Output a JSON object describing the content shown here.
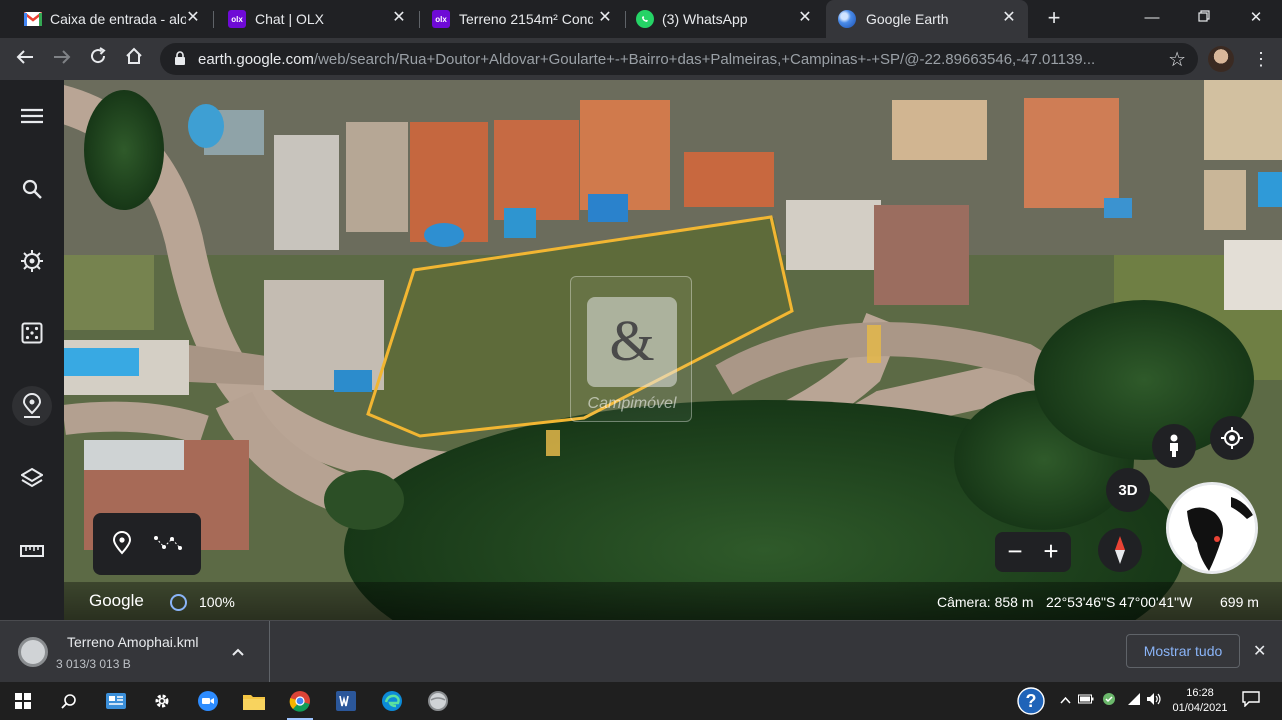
{
  "tabs": [
    {
      "title": "Caixa de entrada - alo",
      "favicon": "gmail-icon"
    },
    {
      "title": "Chat | OLX",
      "favicon": "olx-icon"
    },
    {
      "title": "Terreno 2154m² Cond",
      "favicon": "olx-icon"
    },
    {
      "title": "(3) WhatsApp",
      "favicon": "whatsapp-icon"
    },
    {
      "title": "Google Earth",
      "favicon": "google-earth-icon",
      "active": true
    }
  ],
  "colors": {
    "tab_bar": "#202124",
    "toolbar": "#35363a",
    "accent_blue": "#8ab4f8",
    "plot_outline": "#f2b632",
    "olx_purple": "#6e0ad6",
    "whatsapp_green": "#25d366"
  },
  "address_bar": {
    "host": "earth.google.com",
    "path": "/web/search/Rua+Doutor+Aldovar+Goularte+-+Bairro+das+Palmeiras,+Campinas+-+SP/@-22.89663546,-47.01139..."
  },
  "sidebar": {
    "items": [
      "menu-icon",
      "search-icon",
      "voyager-icon",
      "feeling-lucky-icon",
      "projects-icon",
      "map-style-icon",
      "measure-icon"
    ]
  },
  "watermark": {
    "symbol": "&",
    "text": "Campimóvel"
  },
  "map_controls": {
    "btn_3d": "3D",
    "zoom_out": "−",
    "zoom_in": "+"
  },
  "status": {
    "logo": "Google",
    "load_pct": "100%",
    "camera": "Câmera: 858 m",
    "coords": "22°53'46\"S 47°00'41\"W",
    "scale": "699 m"
  },
  "download": {
    "filename": "Terreno Amophai.kml",
    "size": "3 013/3 013 B",
    "show_all": "Mostrar tudo"
  },
  "taskbar": {
    "time": "16:28",
    "date": "01/04/2021"
  }
}
